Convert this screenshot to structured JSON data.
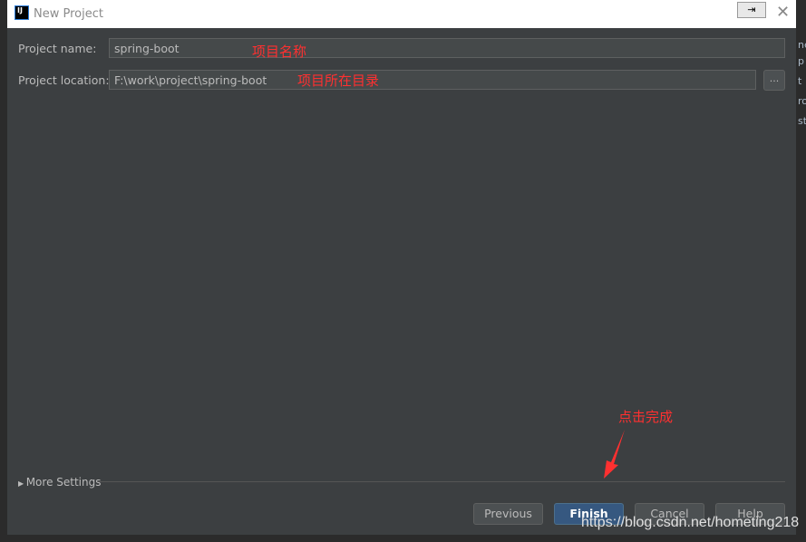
{
  "window": {
    "title": "New Project",
    "icon": "intellij-logo",
    "logo_text": "IJ"
  },
  "form": {
    "name_label": "Project name:",
    "name_value": "spring-boot",
    "location_label": "Project location:",
    "location_value": "F:\\work\\project\\spring-boot",
    "browse_label": "..."
  },
  "annotations": {
    "name_note": "项目名称",
    "location_note": "项目所在目录",
    "finish_note": "点击完成",
    "color": "#ff3030"
  },
  "more_settings": "More Settings",
  "buttons": {
    "previous": "Previous",
    "finish": "Finish",
    "cancel": "Cancel",
    "help": "Help"
  },
  "watermark": "https://blog.csdn.net/hometing218",
  "editor_fragments": [
    "ne",
    "p",
    "t",
    "ro",
    "st"
  ]
}
